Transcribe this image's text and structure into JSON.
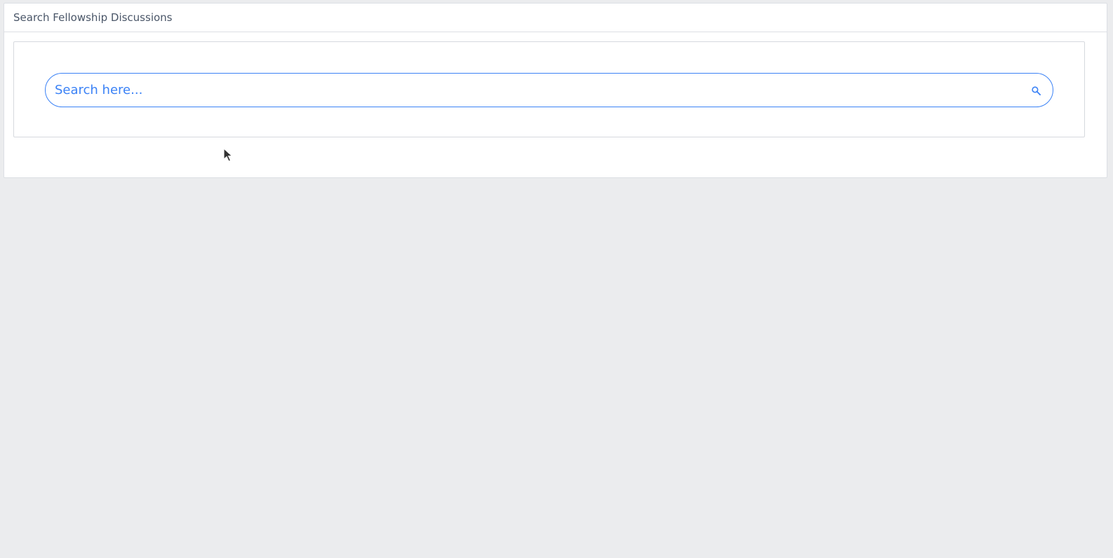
{
  "card": {
    "title": "Search Fellowship Discussions"
  },
  "search": {
    "placeholder": "Search here...",
    "value": "",
    "icon": "search-icon"
  },
  "colors": {
    "accent": "#3b82f6",
    "background": "#ebecee",
    "header_text": "#4a5668"
  }
}
